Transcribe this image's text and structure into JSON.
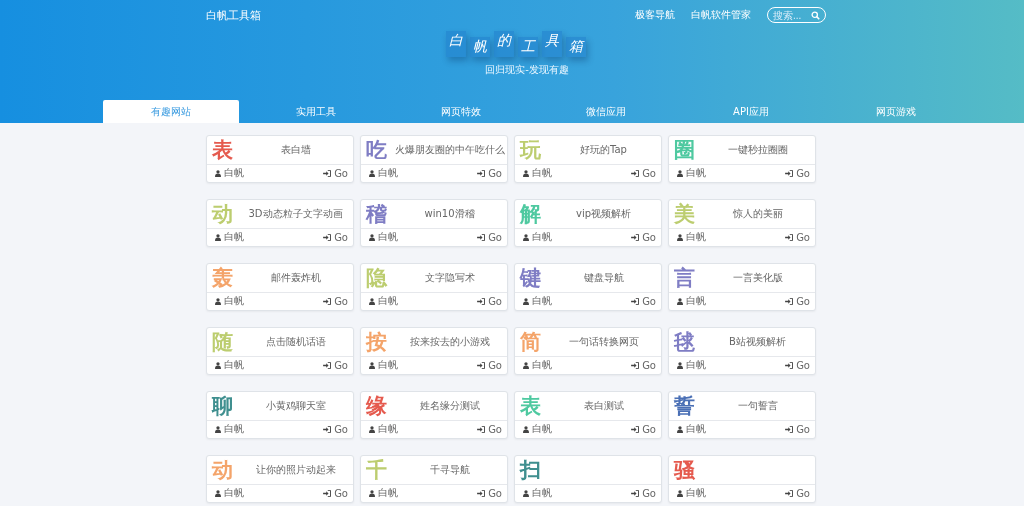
{
  "brand": "白帆工具箱",
  "nav_links": [
    "极客导航",
    "白帆软件管家"
  ],
  "search": {
    "placeholder": "搜索..."
  },
  "hero": {
    "title_chars": [
      "白",
      "帆",
      "的",
      "工",
      "具",
      "箱"
    ],
    "subtitle": "回归现实-发现有趣"
  },
  "tabs": [
    {
      "label": "有趣网站",
      "selected": true
    },
    {
      "label": "实用工具",
      "selected": false
    },
    {
      "label": "网页特效",
      "selected": false
    },
    {
      "label": "微信应用",
      "selected": false
    },
    {
      "label": "API应用",
      "selected": false
    },
    {
      "label": "网页游戏",
      "selected": false
    }
  ],
  "cards": [
    {
      "char": "表",
      "color": "#e55a4e",
      "desc": "表白墙",
      "author": "白帆",
      "action": "Go"
    },
    {
      "char": "吃",
      "color": "#7f7dc4",
      "desc": "火爆朋友圈的中午吃什么",
      "author": "白帆",
      "action": "Go"
    },
    {
      "char": "玩",
      "color": "#bccd6f",
      "desc": "好玩的Tap",
      "author": "白帆",
      "action": "Go"
    },
    {
      "char": "圈",
      "color": "#4ec9a0",
      "desc": "一键秒拉圈圈",
      "author": "白帆",
      "action": "Go"
    },
    {
      "char": "动",
      "color": "#bccd6f",
      "desc": "3D动态粒子文字动画",
      "author": "白帆",
      "action": "Go"
    },
    {
      "char": "稽",
      "color": "#7f7dc4",
      "desc": "win10滑稽",
      "author": "白帆",
      "action": "Go"
    },
    {
      "char": "解",
      "color": "#4ec9a0",
      "desc": "vip视频解析",
      "author": "白帆",
      "action": "Go"
    },
    {
      "char": "美",
      "color": "#bccd6f",
      "desc": "惊人的美丽",
      "author": "白帆",
      "action": "Go"
    },
    {
      "char": "轰",
      "color": "#f4a46a",
      "desc": "邮件轰炸机",
      "author": "白帆",
      "action": "Go"
    },
    {
      "char": "隐",
      "color": "#bccd6f",
      "desc": "文字隐写术",
      "author": "白帆",
      "action": "Go"
    },
    {
      "char": "键",
      "color": "#7f7dc4",
      "desc": "键盘导航",
      "author": "白帆",
      "action": "Go"
    },
    {
      "char": "言",
      "color": "#7f7dc4",
      "desc": "一言美化版",
      "author": "白帆",
      "action": "Go"
    },
    {
      "char": "随",
      "color": "#bccd6f",
      "desc": "点击随机话语",
      "author": "白帆",
      "action": "Go"
    },
    {
      "char": "按",
      "color": "#f4a46a",
      "desc": "按来按去的小游戏",
      "author": "白帆",
      "action": "Go"
    },
    {
      "char": "简",
      "color": "#f4a46a",
      "desc": "一句话转换网页",
      "author": "白帆",
      "action": "Go"
    },
    {
      "char": "毬",
      "color": "#7f7dc4",
      "desc": "B站视频解析",
      "author": "白帆",
      "action": "Go"
    },
    {
      "char": "聊",
      "color": "#3f8f8f",
      "desc": "小黄鸡聊天室",
      "author": "白帆",
      "action": "Go"
    },
    {
      "char": "缘",
      "color": "#e55a4e",
      "desc": "姓名缘分测试",
      "author": "白帆",
      "action": "Go"
    },
    {
      "char": "表",
      "color": "#4ec9a0",
      "desc": "表白测试",
      "author": "白帆",
      "action": "Go"
    },
    {
      "char": "誓",
      "color": "#4a6fb5",
      "desc": "一句誓言",
      "author": "白帆",
      "action": "Go"
    },
    {
      "char": "动",
      "color": "#f4a46a",
      "desc": "让你的照片动起来",
      "author": "白帆",
      "action": "Go"
    },
    {
      "char": "千",
      "color": "#bccd6f",
      "desc": "千寻导航",
      "author": "白帆",
      "action": "Go"
    },
    {
      "char": "扫",
      "color": "#3f8f8f",
      "author": "白帆",
      "action": "Go"
    },
    {
      "char": "骚",
      "color": "#e55a4e",
      "author": "白帆",
      "action": "Go"
    }
  ]
}
